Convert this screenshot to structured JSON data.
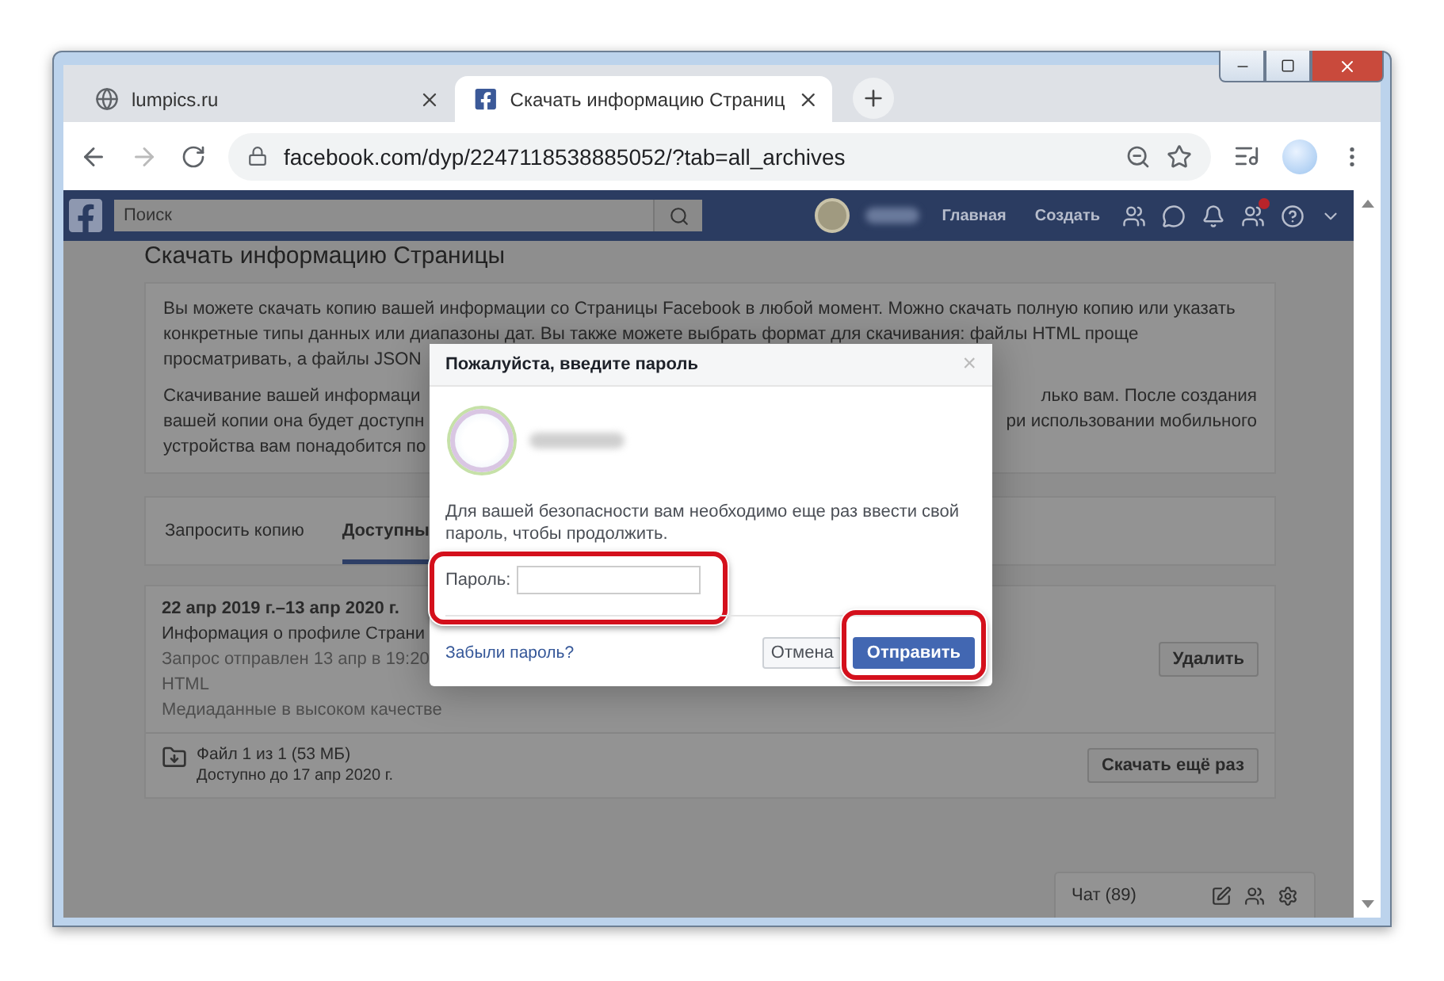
{
  "browser": {
    "tabs": [
      {
        "kind": "globe",
        "title": "lumpics.ru",
        "selected": false
      },
      {
        "kind": "facebook",
        "title": "Скачать информацию Страниц",
        "selected": true
      }
    ],
    "address": "facebook.com/dyp/2247118538885052/?tab=all_archives"
  },
  "facebook_bar": {
    "search": {
      "placeholder": "Поиск"
    },
    "nav": [
      "Главная",
      "Создать"
    ]
  },
  "page": {
    "title": "Скачать информацию Страницы",
    "intro": [
      [
        {
          "left": "Вы можете скачать копию вашей информации со Страницы Facebook в любой момент. Можно скачать полную копию или указать"
        },
        {
          "left": "конкретные типы данных или диапазоны дат. Вы также можете выбрать формат для скачивания: файлы HTML проще"
        },
        {
          "left": "просматривать, а файлы JSON"
        }
      ],
      [
        {
          "left": "Скачивание вашей информаци",
          "right": "лько вам. После создания"
        },
        {
          "left": "вашей копии она будет доступн",
          "right": "ри использовании мобильного"
        },
        {
          "left": "устройства вам понадобится по"
        }
      ]
    ],
    "tabs": [
      {
        "label": "Запросить копию",
        "selected": false
      },
      {
        "label": "Доступны",
        "selected": true
      }
    ],
    "archive": {
      "date_range": "22 апр 2019 г.–13 апр 2020 г.",
      "title": "Информация о профиле Страни",
      "details": [
        "Запрос отправлен 13 апр в 19:20",
        "HTML",
        "Медиаданные в высоком качестве"
      ],
      "delete": "Удалить",
      "file": {
        "name": "Файл 1 из 1 (53 МБ)",
        "available": "Доступно до 17 апр 2020 г.",
        "download": "Скачать ещё раз"
      }
    }
  },
  "chat": {
    "label": "Чат (89)"
  },
  "dialog": {
    "title": "Пожалуйста, введите пароль",
    "close": "×",
    "message": "Для вашей безопасности вам необходимо еще раз ввести свой пароль, чтобы продолжить.",
    "password_label": "Пароль:",
    "forgot": "Забыли пароль?",
    "cancel": "Отмена",
    "submit": "Отправить"
  }
}
